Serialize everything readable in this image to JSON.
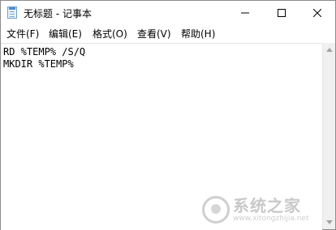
{
  "window": {
    "title": "无标题 - 记事本",
    "icon": "notepad-icon"
  },
  "caption_buttons": {
    "minimize": "minimize-icon",
    "maximize": "maximize-icon",
    "close": "close-icon"
  },
  "menu": {
    "items": [
      {
        "label": "文件(F)"
      },
      {
        "label": "编辑(E)"
      },
      {
        "label": "格式(O)"
      },
      {
        "label": "查看(V)"
      },
      {
        "label": "帮助(H)"
      }
    ]
  },
  "editor": {
    "lines": [
      "RD %TEMP% /S/Q",
      "MKDIR %TEMP%"
    ]
  },
  "watermark": {
    "title": "系统之家",
    "url": "www.xitongzhijia.net"
  }
}
